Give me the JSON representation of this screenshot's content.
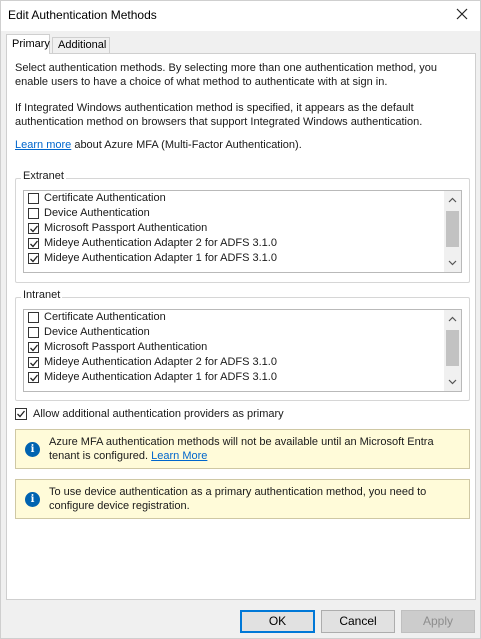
{
  "window": {
    "title": "Edit Authentication Methods",
    "close_icon": "close-icon"
  },
  "tabs": [
    {
      "label": "Primary"
    },
    {
      "label": "Additional"
    }
  ],
  "text": {
    "intro": "Select authentication methods. By selecting more than one authentication method, you enable users to have a choice of what method to authenticate with at sign in.",
    "integrated": "If Integrated Windows authentication method is specified, it appears as the default authentication method on browsers that support Integrated Windows authentication.",
    "learn_more_link": "Learn more",
    "learn_more_rest": " about Azure MFA (Multi-Factor Authentication)."
  },
  "extranet": {
    "label": "Extranet",
    "items": [
      {
        "label": "Certificate Authentication",
        "checked": false
      },
      {
        "label": "Device Authentication",
        "checked": false
      },
      {
        "label": "Microsoft Passport Authentication",
        "checked": true
      },
      {
        "label": "Mideye Authentication Adapter 2 for ADFS 3.1.0",
        "checked": true
      },
      {
        "label": "Mideye Authentication Adapter 1 for ADFS 3.1.0",
        "checked": true
      }
    ]
  },
  "intranet": {
    "label": "Intranet",
    "items": [
      {
        "label": "Certificate Authentication",
        "checked": false
      },
      {
        "label": "Device Authentication",
        "checked": false
      },
      {
        "label": "Microsoft Passport Authentication",
        "checked": true
      },
      {
        "label": "Mideye Authentication Adapter 2 for ADFS 3.1.0",
        "checked": true
      },
      {
        "label": "Mideye Authentication Adapter 1 for ADFS 3.1.0",
        "checked": true
      }
    ]
  },
  "allow_primary": {
    "label": "Allow additional authentication providers as primary",
    "checked": true
  },
  "info": [
    {
      "text": "Azure MFA authentication methods will not be available until an Microsoft Entra tenant is configured.",
      "link": "Learn More"
    },
    {
      "text": "To use device authentication as a primary authentication method, you need to configure device registration."
    }
  ],
  "buttons": {
    "ok": "OK",
    "cancel": "Cancel",
    "apply": "Apply"
  },
  "colors": {
    "link": "#0066cc",
    "info_bg": "#fffbd9",
    "info_icon": "#0063b1",
    "focus_border": "#0078d7"
  }
}
